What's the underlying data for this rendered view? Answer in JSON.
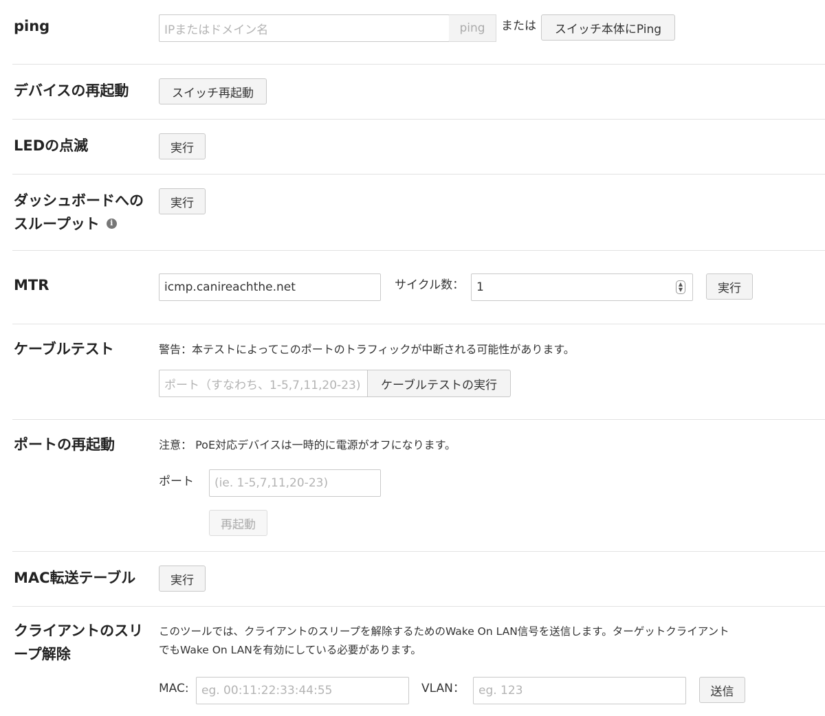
{
  "ping": {
    "label": "ping",
    "input_placeholder": "IPまたはドメイン名",
    "addon": "ping",
    "or_text": "または",
    "self_ping_button": "スイッチ本体にPing"
  },
  "reboot_device": {
    "label": "デバイスの再起動",
    "button": "スイッチ再起動"
  },
  "led_blink": {
    "label": "LEDの点滅",
    "button": "実行"
  },
  "dashboard_throughput": {
    "label_line1": "ダッシュボードへの",
    "label_line2": "スループット",
    "info_icon": "info-icon",
    "button": "実行"
  },
  "mtr": {
    "label": "MTR",
    "host_value": "icmp.canireachthe.net",
    "cycles_label": "サイクル数：",
    "cycles_value": "1",
    "button": "実行"
  },
  "cable_test": {
    "label": "ケーブルテスト",
    "warning": "警告：本テストによってこのポートのトラフィックが中断される可能性があります。",
    "port_placeholder": "ポート（すなわち、1-5,7,11,20-23)",
    "button": "ケーブルテストの実行"
  },
  "port_restart": {
    "label": "ポートの再起動",
    "note": "注意： PoE対応デバイスは一時的に電源がオフになります。",
    "port_label": "ポート",
    "port_placeholder": "(ie. 1-5,7,11,20-23)",
    "button": "再起動"
  },
  "mac_table": {
    "label": "MAC転送テーブル",
    "button": "実行"
  },
  "wake_client": {
    "label_line1": "クライアントのスリ",
    "label_line2": "ープ解除",
    "desc_line1": "このツールでは、クライアントのスリープを解除するためのWake On LAN信号を送信します。ターゲットクライアント",
    "desc_line2": "でもWake On LANを有効にしている必要があります。",
    "mac_label": "MAC:",
    "mac_placeholder": "eg. 00:11:22:33:44:55",
    "vlan_label": "VLAN：",
    "vlan_placeholder": "eg. 123",
    "button": "送信"
  }
}
